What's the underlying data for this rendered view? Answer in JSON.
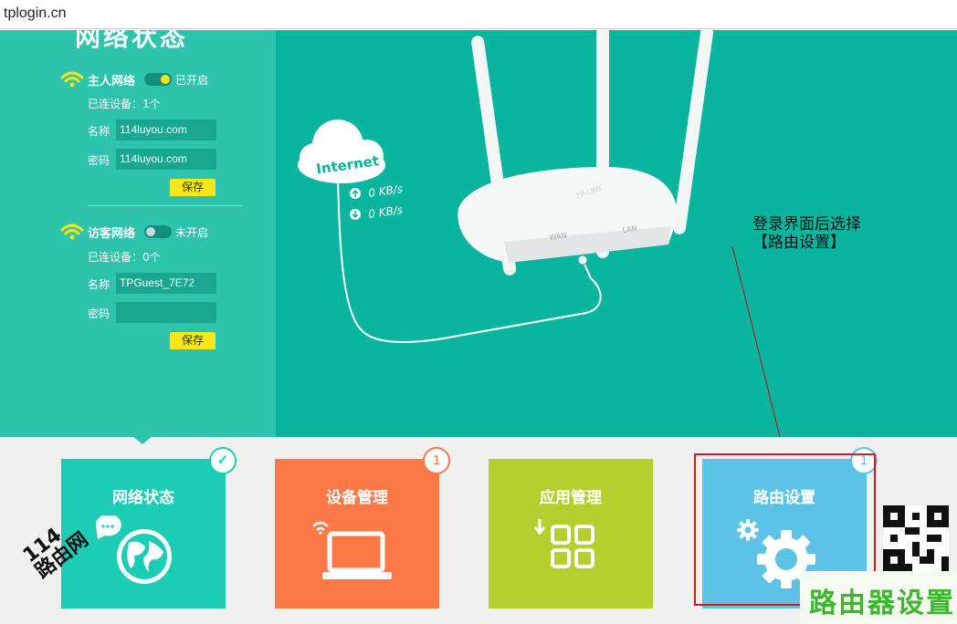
{
  "browser": {
    "url": "tplogin.cn"
  },
  "panel": {
    "title": "网络状态",
    "host": {
      "name": "主人网络",
      "toggle_state": "已开启",
      "connected": "已连设备：1个",
      "name_label": "名称",
      "name_value": "114luyou.com",
      "password_label": "密码",
      "password_value": "114luyou.com",
      "save_label": "保存"
    },
    "guest": {
      "name": "访客网络",
      "toggle_state": "未开启",
      "connected": "已连设备：0个",
      "name_label": "名称",
      "name_value": "TPGuest_7E72",
      "password_label": "密码",
      "password_value": "",
      "save_label": "保存"
    }
  },
  "diagram": {
    "cloud_label": "Internet",
    "upload_speed": "0 KB/s",
    "download_speed": "0 KB/s",
    "router_brand": "TP-LINK",
    "wan_label": "WAN",
    "lan_label": "LAN"
  },
  "annotation": {
    "text": "登录界面后选择\n【路由设置】"
  },
  "tiles": [
    {
      "label": "网络状态",
      "color": "#1ccdb6",
      "badge": "✓",
      "badge_color": "#1ccdb6"
    },
    {
      "label": "设备管理",
      "color": "#fd7847",
      "badge": "1",
      "badge_color": "#fd7847"
    },
    {
      "label": "应用管理",
      "color": "#b5cf2f",
      "badge": "",
      "badge_color": ""
    },
    {
      "label": "路由设置",
      "color": "#5cc3e6",
      "badge": "1",
      "badge_color": "#5cc3e6"
    }
  ],
  "watermark": {
    "text": "114\n路由网"
  },
  "brand": {
    "text": "路由器设置"
  },
  "colors": {
    "accent_teal": "#0ab59f",
    "panel_teal": "#2dc3ad",
    "save_yellow": "#f4e81a",
    "highlight_red": "#e4141e"
  }
}
